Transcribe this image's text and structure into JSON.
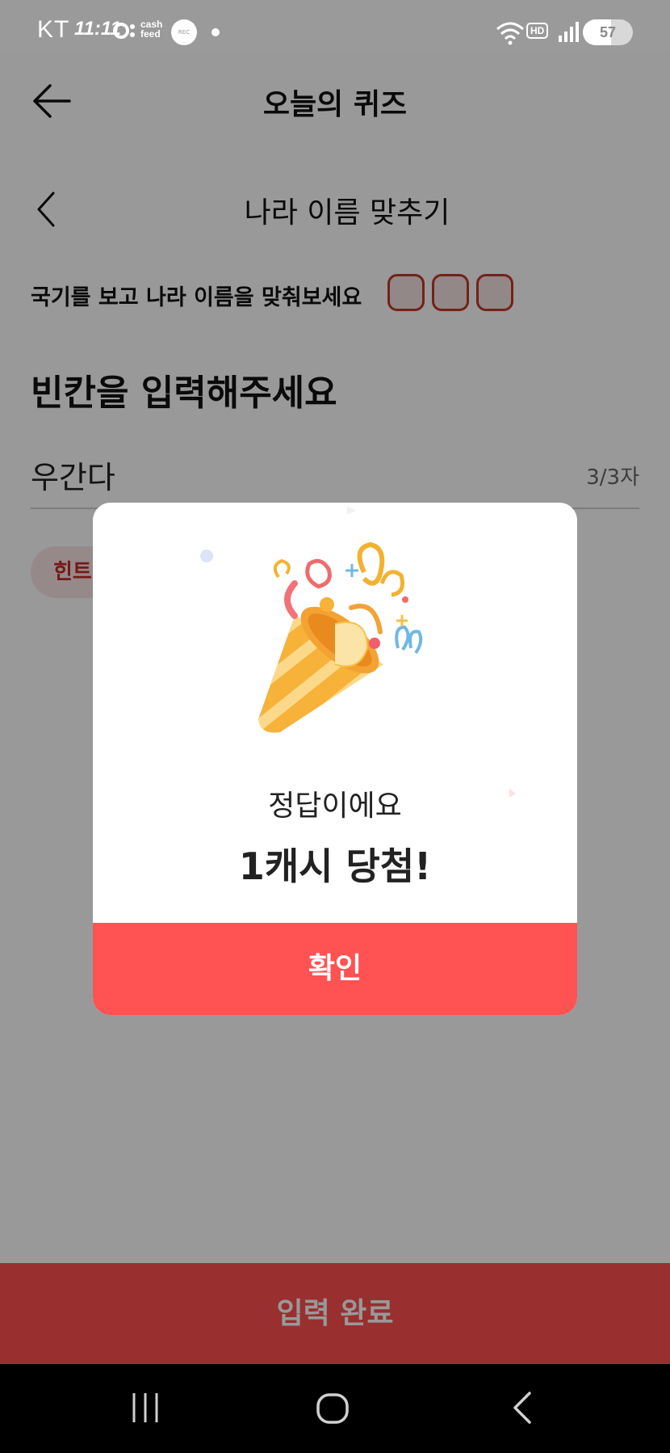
{
  "status_bar": {
    "carrier": "KT",
    "time": "11:11",
    "cashfeed_line1": "cash",
    "cashfeed_line2": "feed",
    "rec": "REC",
    "hd": "HD",
    "battery_level": "57"
  },
  "header": {
    "title": "오늘의 퀴즈"
  },
  "quiz": {
    "title": "나라 이름 맞추기",
    "instruction": "국기를 보고  나라 이름을 맞춰보세요",
    "heading": "빈칸을 입력해주세요",
    "answer_value": "우간다",
    "char_count": "3/3자",
    "hint_label": "힌트"
  },
  "dialog": {
    "message": "정답이에요",
    "reward": "1캐시 당첨!",
    "confirm_label": "확인"
  },
  "submit": {
    "label": "입력 완료"
  },
  "colors": {
    "accent": "#ff5252",
    "overlay": "rgba(0,0,0,0.4)"
  },
  "icons": {
    "back": "arrow-left-icon",
    "quiz_back": "chevron-left-icon",
    "nav_recents": "recents-icon",
    "nav_home": "home-icon",
    "nav_back": "chevron-left-icon"
  }
}
